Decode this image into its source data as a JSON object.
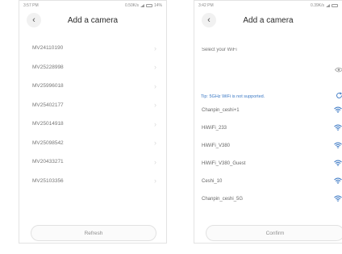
{
  "left_screen": {
    "status": {
      "time": "3:57 PM",
      "speed": "0.50K/s",
      "battery": "14%"
    },
    "title": "Add a camera",
    "back_label": "‹",
    "devices": [
      "MV24110190",
      "MV25228998",
      "MV25996018",
      "MV25402177",
      "MV25014918",
      "MV25098542",
      "MV20433271",
      "MV25103356"
    ],
    "refresh_label": "Refresh"
  },
  "right_screen": {
    "status": {
      "time": "3:42 PM",
      "speed": "0.39K/s"
    },
    "title": "Add a camera",
    "back_label": "‹",
    "wifi_placeholder": "Select your WiFi",
    "tip": "Tip: 5GHz WiFi is not supported.",
    "networks": [
      "Chanpin_ceshi+1",
      "HiWiFi_233",
      "HiWiFi_V380",
      "HiWiFi_V380_Guest",
      "Ceshi_10",
      "Chanpin_ceshi_5G"
    ],
    "confirm_label": "Confirm"
  },
  "icons": {
    "chevron": "chevron-right-icon",
    "wifi": "wifi-icon",
    "eye": "eye-icon",
    "refresh": "refresh-icon"
  },
  "colors": {
    "accent": "#3b78c4",
    "text": "#777777",
    "title": "#2a2a2a"
  }
}
